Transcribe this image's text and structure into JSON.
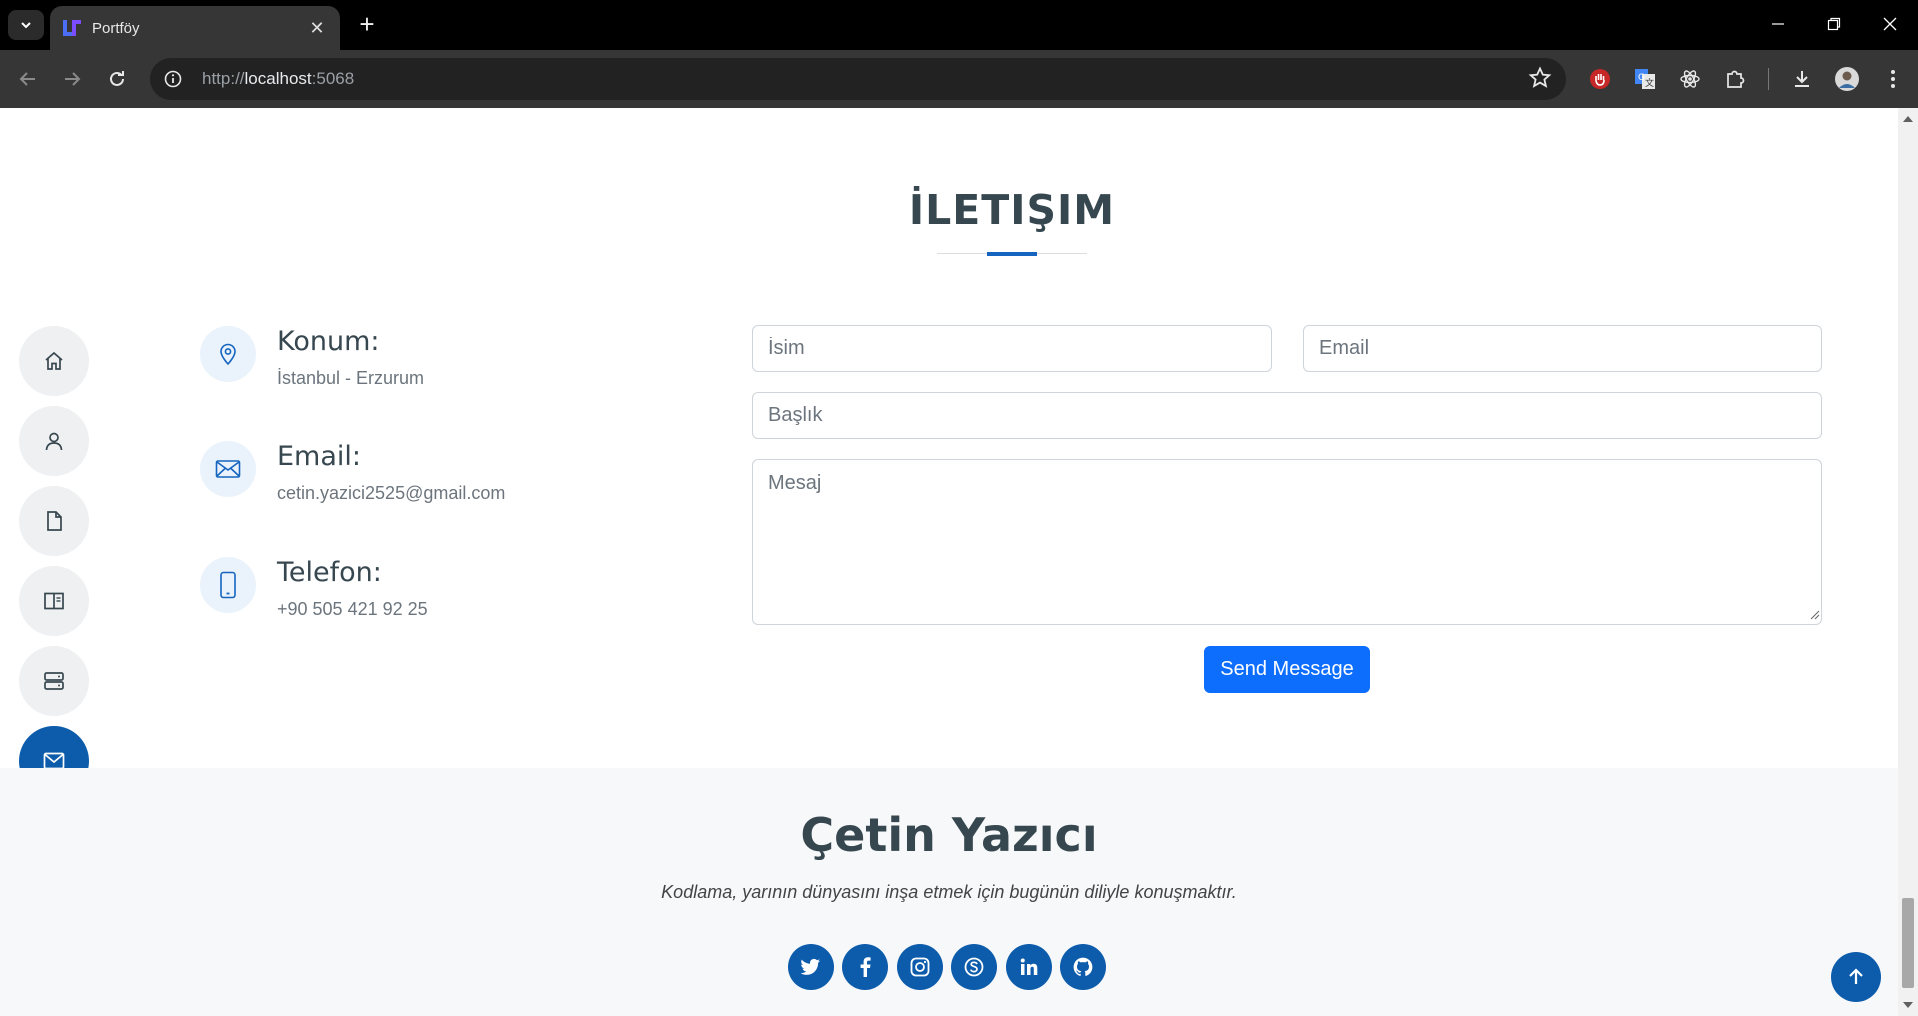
{
  "browser": {
    "tab_title": "Portföy",
    "url_scheme": "http://",
    "url_host": "localhost",
    "url_port": ":5068"
  },
  "contact": {
    "section_title": "İLETIŞIM",
    "items": [
      {
        "label": "Konum:",
        "value": "İstanbul - Erzurum",
        "icon": "map-pin-icon"
      },
      {
        "label": "Email:",
        "value": "cetin.yazici2525@gmail.com",
        "icon": "envelope-icon"
      },
      {
        "label": "Telefon:",
        "value": "+90 505 421 92 25",
        "icon": "phone-icon"
      }
    ],
    "form": {
      "name_placeholder": "İsim",
      "email_placeholder": "Email",
      "subject_placeholder": "Başlık",
      "message_placeholder": "Mesaj",
      "submit_label": "Send Message"
    }
  },
  "sidenav": {
    "items": [
      "home-icon",
      "user-icon",
      "file-icon",
      "book-icon",
      "server-icon",
      "envelope-icon"
    ],
    "active": "envelope-icon"
  },
  "footer": {
    "name": "Çetin Yazıcı",
    "quote": "Kodlama, yarının dünyasını inşa etmek için bugünün diliyle konuşmaktır.",
    "socials": [
      "twitter-icon",
      "facebook-icon",
      "instagram-icon",
      "skype-icon",
      "linkedin-icon",
      "github-icon"
    ]
  },
  "colors": {
    "accent": "#0d5cab",
    "button": "#0d6efd",
    "heading": "#37474f"
  }
}
